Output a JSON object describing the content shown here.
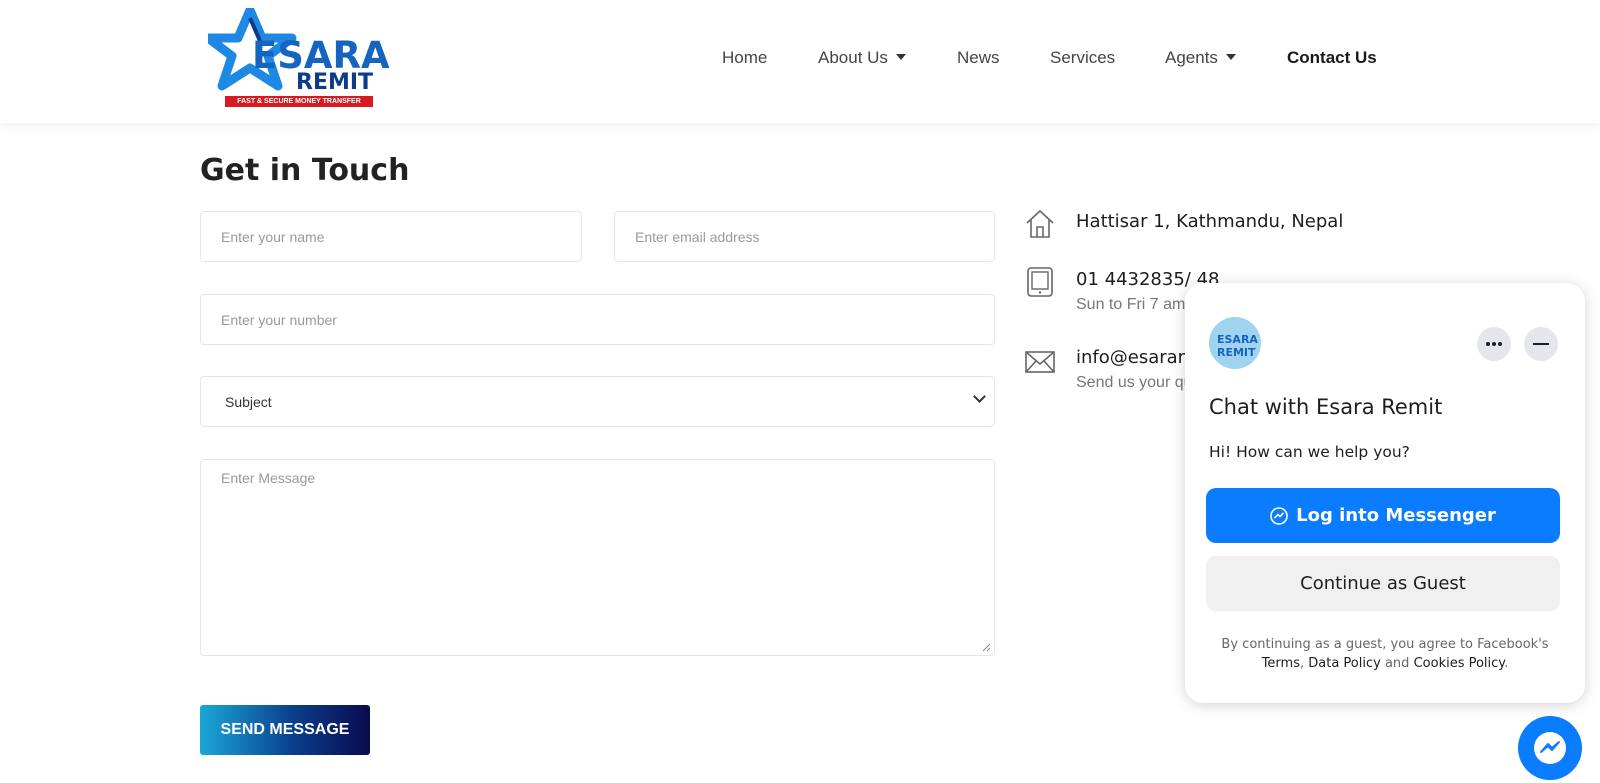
{
  "header": {
    "logo": {
      "word1": "ESARA",
      "word2": "REMIT",
      "tagline": "FAST & SECURE MONEY TRANSFER"
    },
    "nav": [
      {
        "label": "Home",
        "dropdown": false,
        "active": false
      },
      {
        "label": "About Us",
        "dropdown": true,
        "active": false
      },
      {
        "label": "News",
        "dropdown": false,
        "active": false
      },
      {
        "label": "Services",
        "dropdown": false,
        "active": false
      },
      {
        "label": "Agents",
        "dropdown": true,
        "active": false
      },
      {
        "label": "Contact Us",
        "dropdown": false,
        "active": true
      }
    ]
  },
  "form": {
    "title": "Get in Touch",
    "name_placeholder": "Enter your name",
    "email_placeholder": "Enter email address",
    "number_placeholder": "Enter your number",
    "subject_value": "Subject",
    "message_placeholder": "Enter Message",
    "submit_label": "SEND MESSAGE"
  },
  "contact": {
    "address": "Hattisar 1, Kathmandu, Nepal",
    "phone": "01 4432835/ 48",
    "hours": "Sun to Fri 7 am",
    "email": "info@esarare",
    "email_note": "Send us your qu",
    "icons": [
      "home-icon",
      "tablet-icon",
      "envelope-icon"
    ]
  },
  "chat": {
    "avatar_text": "ESARA REMIT",
    "title": "Chat with Esara Remit",
    "greeting": "Hi! How can we help you?",
    "login_label": "Log into Messenger",
    "guest_label": "Continue as Guest",
    "legal_prefix": "By continuing as a guest, you agree to Facebook's",
    "legal_terms": "Terms",
    "legal_data": "Data Policy",
    "legal_and": "and",
    "legal_cookies": "Cookies Policy",
    "accent": "#0a7cff"
  },
  "colors": {
    "brand_blue": "#1565c0",
    "brand_red": "#d81b23",
    "button_gradient_start": "#1ba7d8",
    "button_gradient_end": "#0a0a4e"
  }
}
